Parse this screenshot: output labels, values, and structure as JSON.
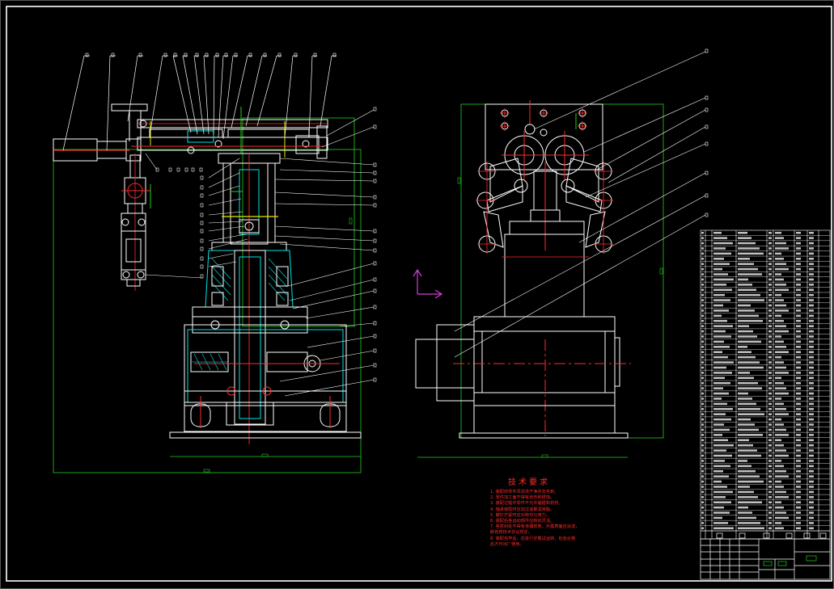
{
  "drawing": {
    "background": "#000000",
    "colors": {
      "outline": "#ffffff",
      "section": "#00e5e5",
      "center": "#ff2a2a",
      "dimension": "#22cc22",
      "leader": "#ffffff",
      "axis": "#d63cd6",
      "yellow": "#e8e800"
    },
    "left_view": {
      "name": "manipulator-section-view",
      "top_callouts": 15,
      "right_callouts": 19,
      "left_callouts": 13
    },
    "right_view": {
      "name": "gripper-side-view",
      "right_callouts": 9
    }
  },
  "technical_requirements": {
    "title": "技术要求",
    "lines": [
      "1. 装配前零件须清洗干净并去毛刺。",
      "2. 零件加工面不得有划伤和锈蚀。",
      "3. 装配过程中零件不允许磕碰和划伤。",
      "4. 轴承装配时应加注适量润滑脂。",
      "5. 螺钉拧紧时应对称均匀用力。",
      "6. 装配后各运动部件应转动灵活。",
      "7. 各密封处不得有渗漏现象，外露表面应涂漆，",
      "   颜色按技术协议规定。",
      "8. 装配完毕后，应进行空载试运转，检验合格",
      "   后方可出厂使用。"
    ]
  },
  "parts_list": {
    "rows": 58
  },
  "title_block": {
    "present": true
  }
}
